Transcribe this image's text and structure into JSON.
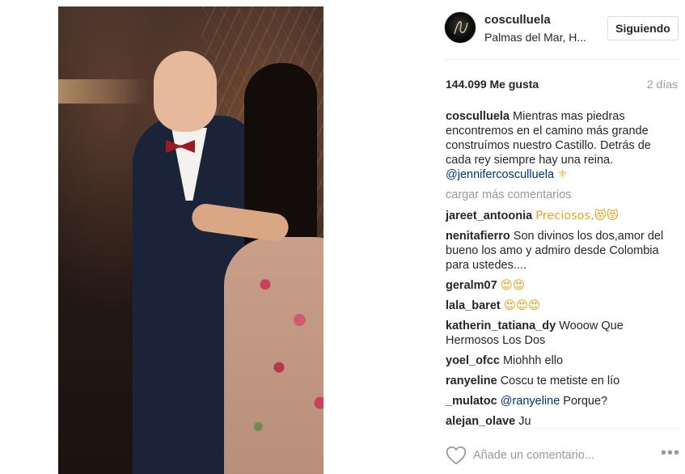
{
  "post": {
    "author": "cosculluela",
    "location": "Palmas del Mar, H...",
    "follow_label": "Siguiendo",
    "likes": "144.099 Me gusta",
    "age": "2 días",
    "photo_alt": "post-photo"
  },
  "caption": {
    "user": "cosculluela",
    "text": "Mientras mas piedras encontremos en el camino más grande construímos nuestro Castillo. Detrás de cada rey siempre hay una reina.",
    "mention": "@jennifercosculluela",
    "emoji": "⚜"
  },
  "load_more_label": "cargar más comentarios",
  "comments": [
    {
      "user": "jareet_antoonia",
      "text": "Preciosos,😻😻"
    },
    {
      "user": "nenitafierro",
      "text": "Son divinos los dos,amor del bueno los amo y admiro desde Colombia para ustedes...."
    },
    {
      "user": "geralm07",
      "text": "😍😍"
    },
    {
      "user": "lala_baret",
      "text": "😍😍😍"
    },
    {
      "user": "katherin_tatiana_dy",
      "text": "Wooow Que Hermosos Los Dos"
    },
    {
      "user": "yoel_ofcc",
      "text": "Miohhh ello"
    },
    {
      "user": "ranyeline",
      "text": "Coscu te metiste en lío"
    },
    {
      "user": "_mulatoc",
      "mention": "@ranyeline",
      "text": "Porque?"
    },
    {
      "user": "alejan_olave",
      "text": "Ju"
    }
  ],
  "add_comment": {
    "placeholder": "Añade un comentario...",
    "more_label": "•••"
  },
  "colors": {
    "mention": "#003569",
    "muted": "#999999",
    "divider": "#efefef"
  },
  "icons": {
    "like": "heart-outline-icon",
    "more": "more-horizontal-icon"
  }
}
